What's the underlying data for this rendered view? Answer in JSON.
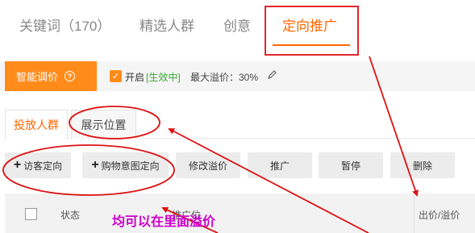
{
  "top_tabs": [
    {
      "label": "关键词（170）"
    },
    {
      "label": "精选人群"
    },
    {
      "label": "创意"
    },
    {
      "label": "定向推广"
    }
  ],
  "smart_bar": {
    "button_label": "智能调价",
    "help_icon_glyph": "?",
    "toggle_label": "开启",
    "status": "[生效中]",
    "max_premium": "最大溢价：30%"
  },
  "sub_tabs": [
    {
      "label": "投放人群"
    },
    {
      "label": "展示位置"
    }
  ],
  "actions": [
    {
      "label": "访客定向"
    },
    {
      "label": "购物意图定向"
    },
    {
      "label": "修改溢价"
    },
    {
      "label": "推广"
    },
    {
      "label": "暂停"
    },
    {
      "label": "删除"
    }
  ],
  "table": {
    "col_status": "状态",
    "col_name": "推广位",
    "col_bid": "出价/溢价"
  },
  "annotation": "均可以在里面溢价",
  "colors": {
    "accent": "#ff6600",
    "smart_button": "#ff8c1a",
    "status_green": "#3ba63b",
    "annotation_red": "#dd1111",
    "annotation_text": "#cc00cc"
  }
}
